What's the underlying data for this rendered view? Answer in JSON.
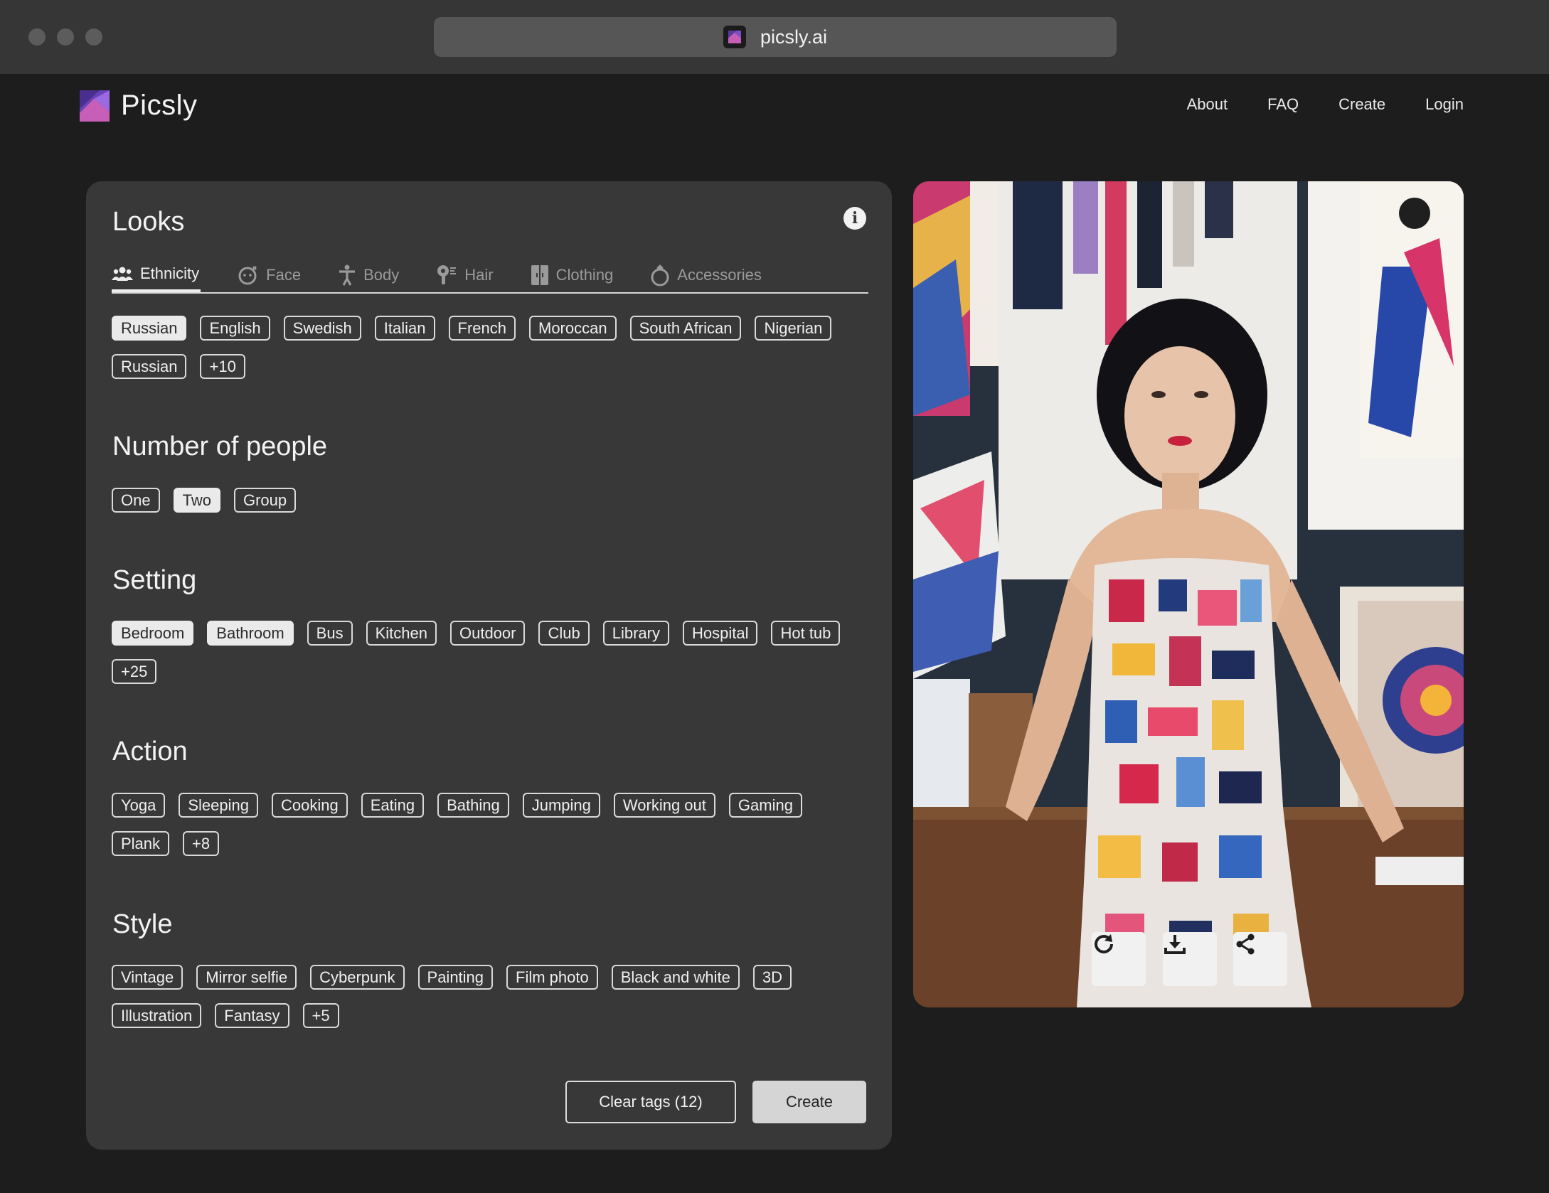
{
  "browser": {
    "url": "picsly.ai"
  },
  "brand": {
    "name": "Picsly",
    "accent": "#8b5cd6"
  },
  "nav": {
    "about": "About",
    "faq": "FAQ",
    "create": "Create",
    "login": "Login"
  },
  "looks": {
    "title": "Looks",
    "tabs": {
      "ethnicity": "Ethnicity",
      "face": "Face",
      "body": "Body",
      "hair": "Hair",
      "clothing": "Clothing",
      "accessories": "Accessories"
    },
    "chips": [
      "Russian",
      "English",
      "Swedish",
      "Italian",
      "French",
      "Moroccan",
      "South African",
      "Nigerian",
      "Russian",
      "+10"
    ]
  },
  "people": {
    "title": "Number of people",
    "chips": [
      "One",
      "Two",
      "Group"
    ]
  },
  "setting": {
    "title": "Setting",
    "chips": [
      "Bedroom",
      "Bathroom",
      "Bus",
      "Kitchen",
      "Outdoor",
      "Club",
      "Library",
      "Hospital",
      "Hot tub",
      "+25"
    ]
  },
  "action": {
    "title": "Action",
    "chips": [
      "Yoga",
      "Sleeping",
      "Cooking",
      "Eating",
      "Bathing",
      "Jumping",
      "Working out",
      "Gaming",
      "Plank",
      "+8"
    ]
  },
  "style": {
    "title": "Style",
    "chips": [
      "Vintage",
      "Mirror selfie",
      "Cyberpunk",
      "Painting",
      "Film photo",
      "Black and white",
      "3D",
      "Illustration",
      "Fantasy",
      "+5"
    ]
  },
  "buttons": {
    "clear": "Clear tags (12)",
    "create": "Create"
  }
}
